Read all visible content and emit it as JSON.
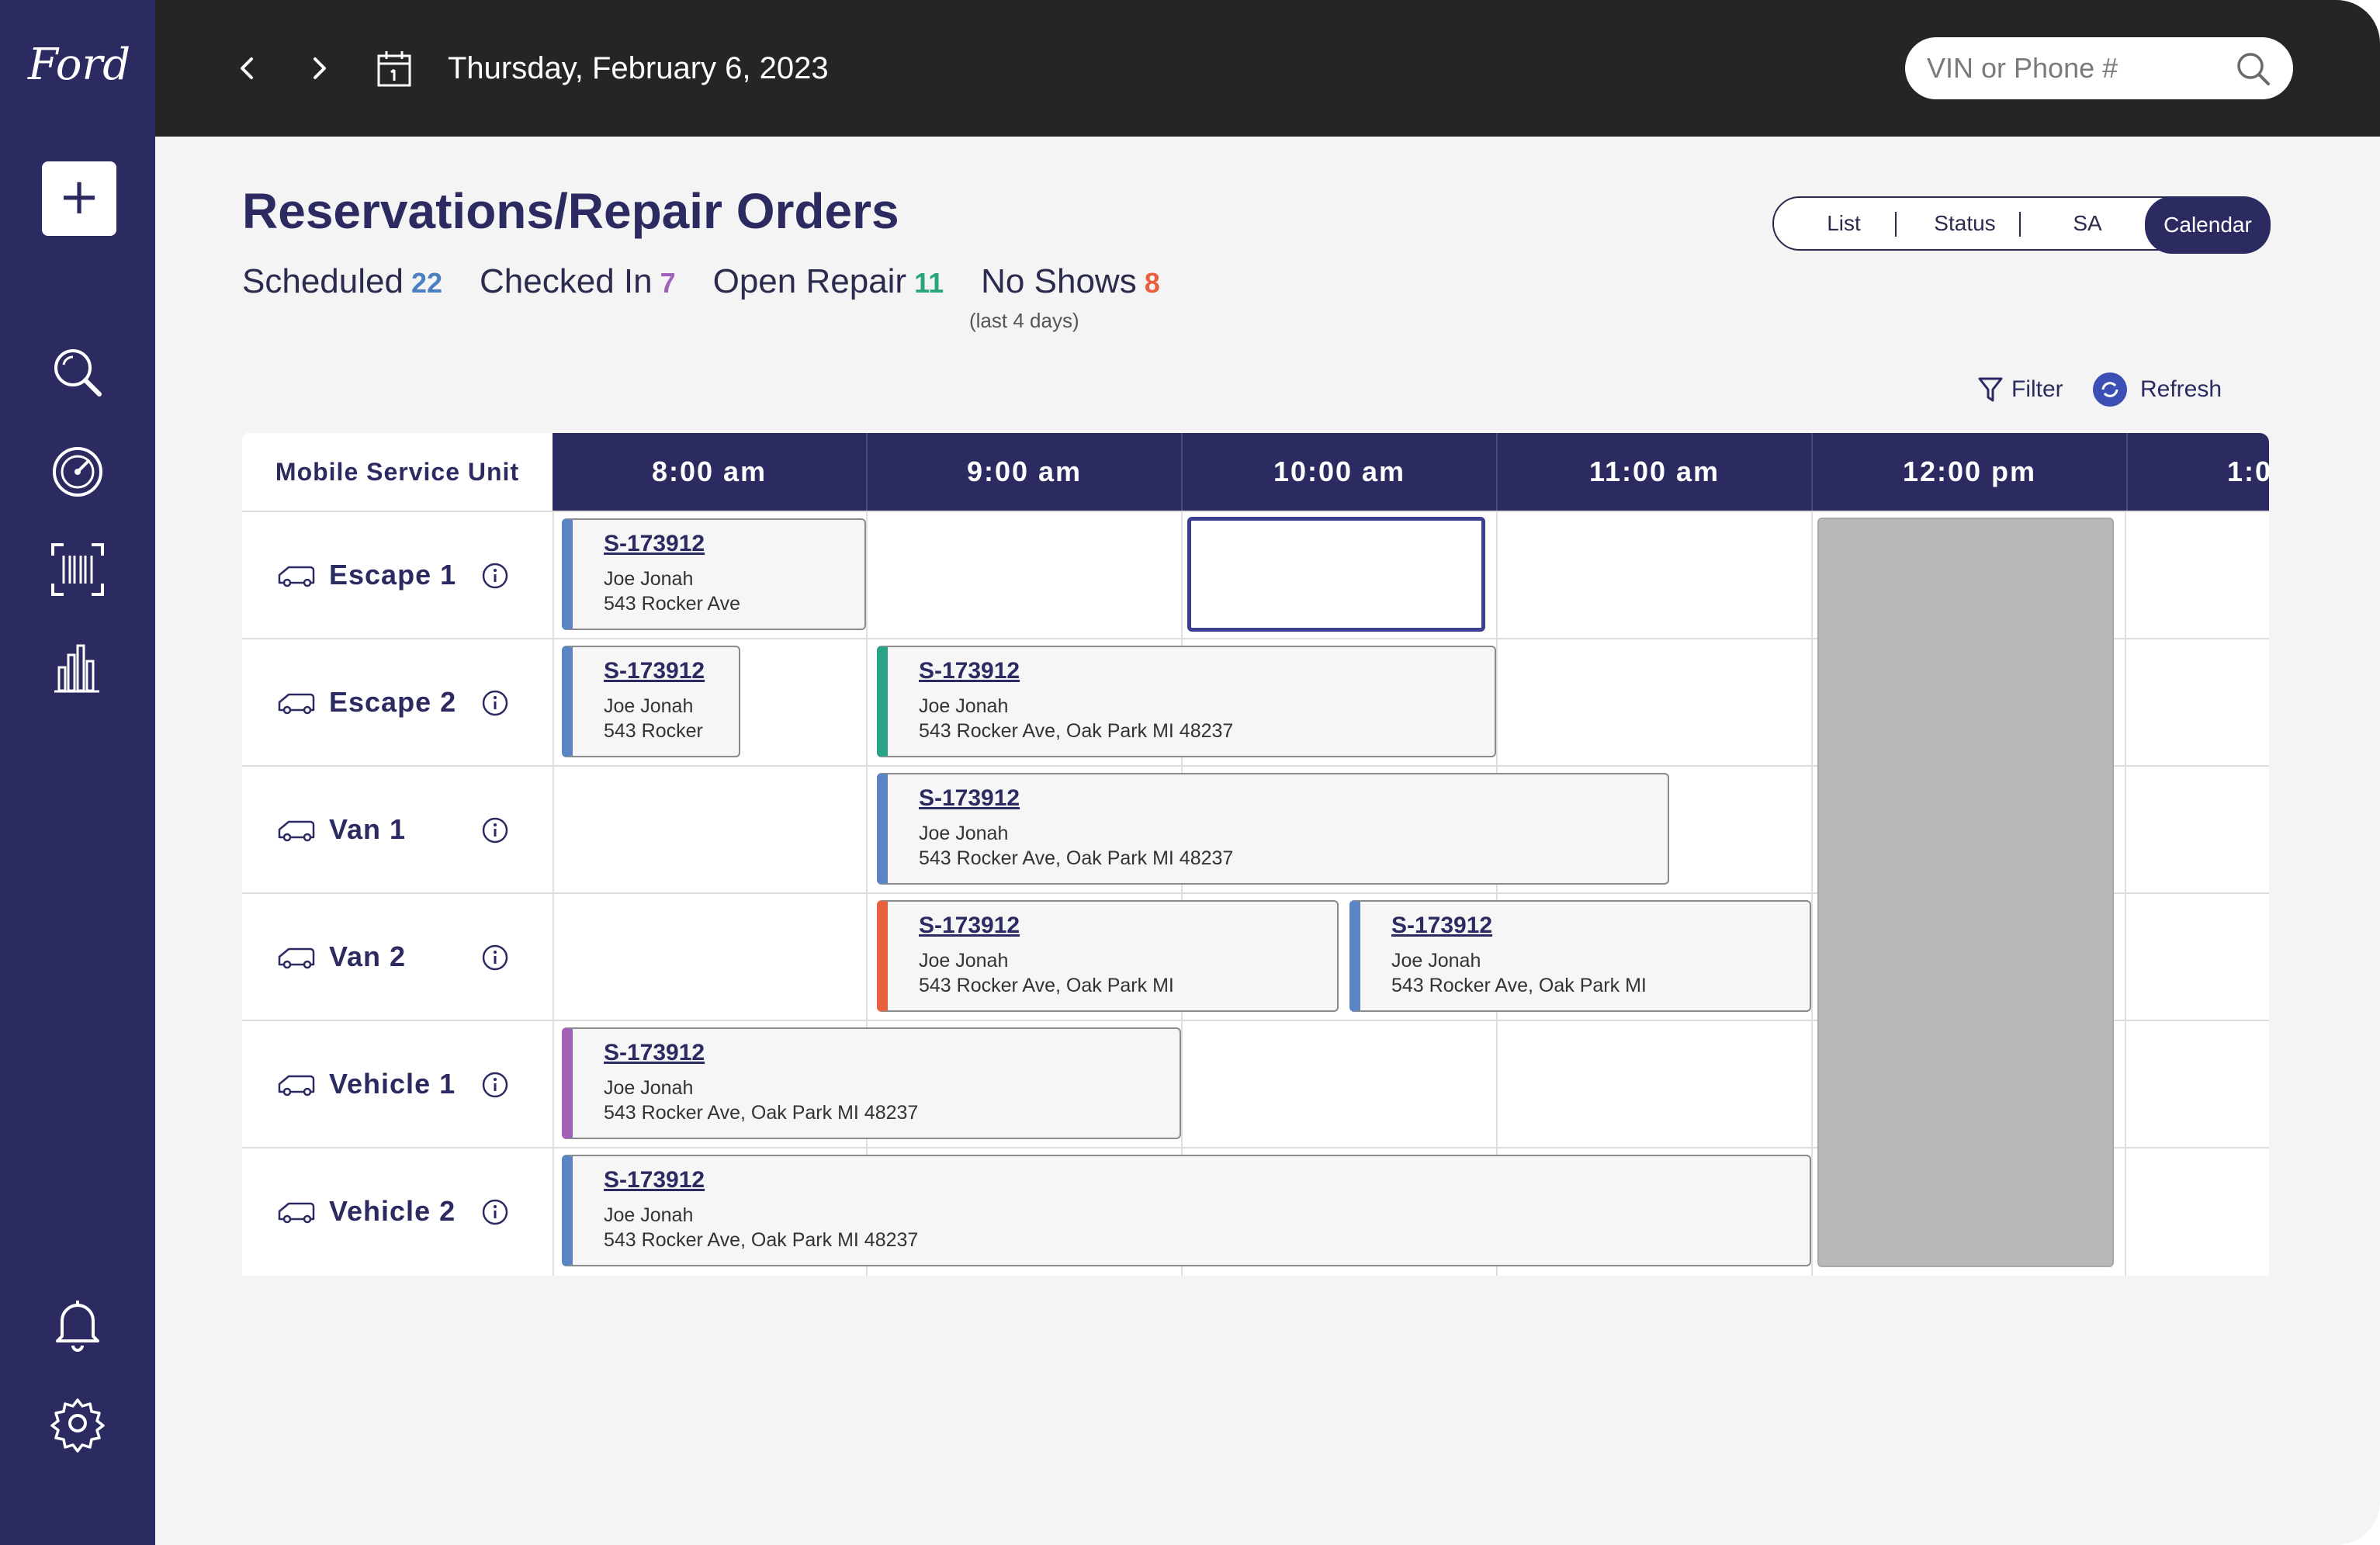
{
  "brand": {
    "logo_text": "Ford"
  },
  "sidebar": {
    "add_label": "+",
    "icons": [
      "search-icon",
      "dashboard-gauge-icon",
      "barcode-scan-icon",
      "bar-chart-icon",
      "bell-icon",
      "gear-icon"
    ]
  },
  "topbar": {
    "date": "Thursday, February 6, 2023",
    "search_placeholder": "VIN or Phone #"
  },
  "header": {
    "title": "Reservations/Repair Orders",
    "stats": [
      {
        "label": "Scheduled",
        "count": "22",
        "color": "#4a7fc1"
      },
      {
        "label": "Checked In",
        "count": "7",
        "color": "#a261b8"
      },
      {
        "label": "Open Repair",
        "count": "11",
        "color": "#2aa37f"
      },
      {
        "label": "No Shows",
        "count": "8",
        "color": "#e8603c"
      }
    ],
    "no_show_note": "(last 4 days)"
  },
  "view_toggle": {
    "options": [
      "List",
      "Status",
      "SA",
      "Calendar"
    ],
    "selected": "Calendar"
  },
  "actions": {
    "filter_label": "Filter",
    "refresh_label": "Refresh"
  },
  "grid": {
    "unit_header": "Mobile Service Unit",
    "times": [
      "8:00 am",
      "9:00 am",
      "10:00 am",
      "11:00 am",
      "12:00 pm",
      "1:00"
    ],
    "units": [
      "Escape 1",
      "Escape 2",
      "Van 1",
      "Van 2",
      "Vehicle 1",
      "Vehicle 2"
    ],
    "appointments": [
      {
        "row": 0,
        "start": 8.0,
        "end": 9.0,
        "id": "S-173912",
        "name": "Joe Jonah",
        "address": "543 Rocker Ave",
        "color": "#5b84c4"
      },
      {
        "row": 1,
        "start": 8.0,
        "end": 8.6,
        "id": "S-173912",
        "name": "Joe Jonah",
        "address": "543 Rocker",
        "color": "#5b84c4"
      },
      {
        "row": 1,
        "start": 9.0,
        "end": 11.0,
        "id": "S-173912",
        "name": "Joe Jonah",
        "address": "543 Rocker Ave, Oak Park MI 48237",
        "color": "#2aa38a"
      },
      {
        "row": 2,
        "start": 9.0,
        "end": 11.55,
        "id": "S-173912",
        "name": "Joe Jonah",
        "address": "543 Rocker Ave, Oak Park MI 48237",
        "color": "#5b84c4"
      },
      {
        "row": 3,
        "start": 9.0,
        "end": 10.5,
        "id": "S-173912",
        "name": "Joe Jonah",
        "address": "543 Rocker Ave, Oak Park MI",
        "color": "#e8603c"
      },
      {
        "row": 3,
        "start": 10.5,
        "end": 12.0,
        "id": "S-173912",
        "name": "Joe Jonah",
        "address": "543 Rocker Ave, Oak Park MI",
        "color": "#5b84c4"
      },
      {
        "row": 4,
        "start": 8.0,
        "end": 10.0,
        "id": "S-173912",
        "name": "Joe Jonah",
        "address": "543 Rocker Ave, Oak Park MI 48237",
        "color": "#a261b8"
      },
      {
        "row": 5,
        "start": 8.0,
        "end": 12.0,
        "id": "S-173912",
        "name": "Joe Jonah",
        "address": "543 Rocker Ave, Oak Park MI 48237",
        "color": "#5b84c4"
      }
    ],
    "selected_slot": {
      "row": 0,
      "start": 10.0,
      "end": 11.0
    },
    "blocked": {
      "start": 12.0,
      "end": 13.0,
      "label": ""
    }
  }
}
